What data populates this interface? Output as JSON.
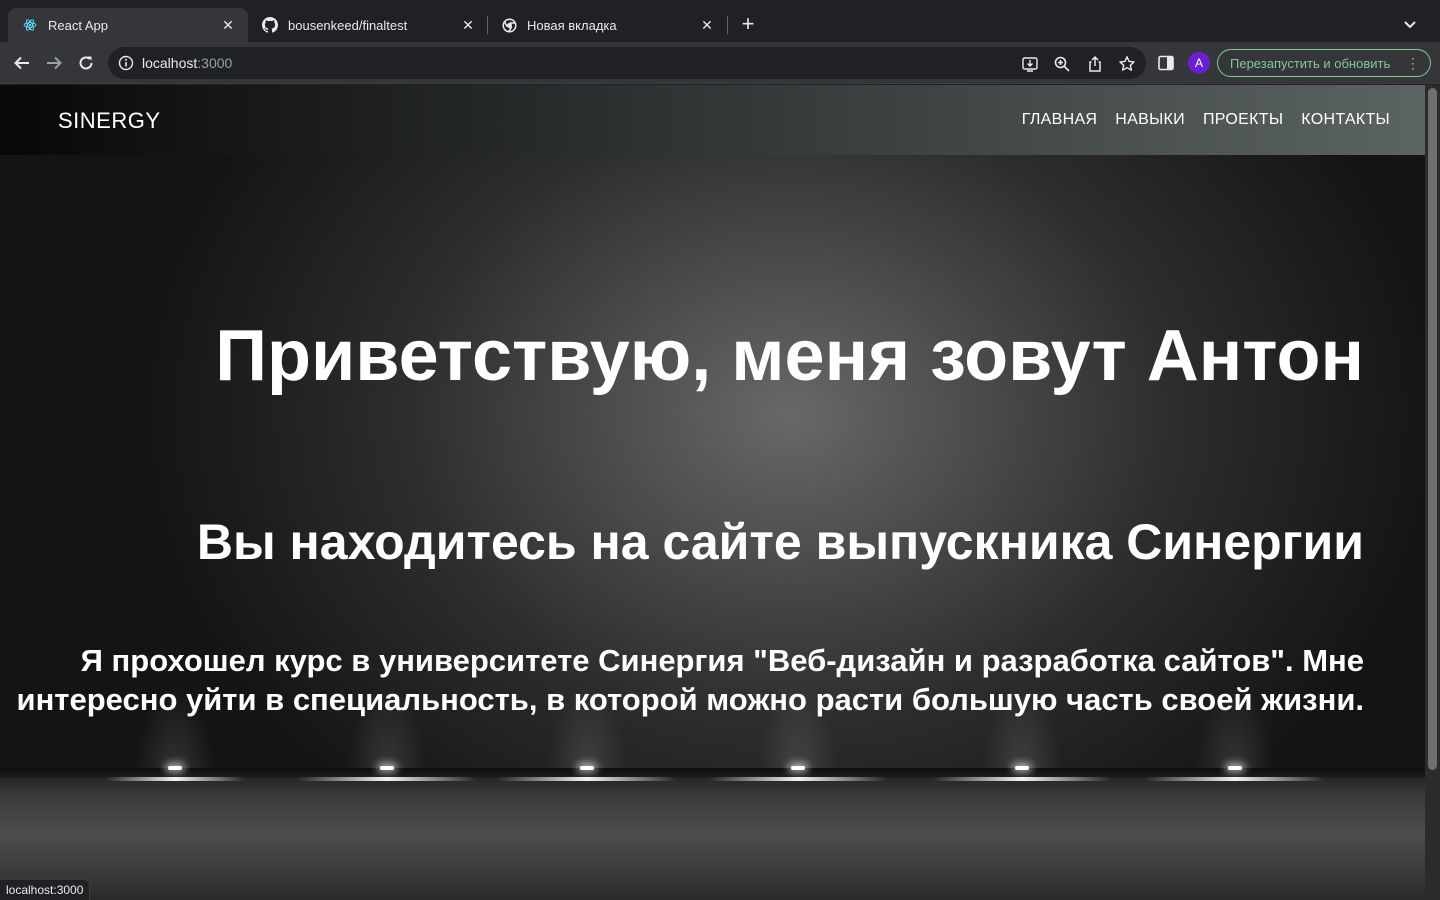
{
  "tabs": [
    {
      "title": "React App",
      "icon": "react-icon",
      "active": true
    },
    {
      "title": "bousenkeed/finaltest",
      "icon": "github-icon",
      "active": false
    },
    {
      "title": "Новая вкладка",
      "icon": "chrome-icon",
      "active": false
    }
  ],
  "omnibox": {
    "host": "localhost",
    "port": ":3000"
  },
  "toolbar": {
    "avatar_letter": "A",
    "relaunch_label": "Перезапустить и обновить"
  },
  "site": {
    "logo": "SINERGY",
    "nav": [
      "ГЛАВНАЯ",
      "НАВЫКИ",
      "ПРОЕКТЫ",
      "КОНТАКТЫ"
    ],
    "heading": "Приветствую, меня зовут Антон",
    "subheading": "Вы находитесь на сайте выпускника Синергии",
    "paragraph": "Я прохошел курс в университете Синергия \"Веб-дизайн и разработка сайтов\". Мне интересно уйти в специальность, в которой можно расти большую часть своей жизни."
  },
  "status": {
    "url": "localhost:3000"
  },
  "colors": {
    "relaunch_accent": "#81c995",
    "avatar_bg": "#6a1fd0",
    "chrome_bg": "#202124",
    "toolbar_bg": "#35363a"
  }
}
